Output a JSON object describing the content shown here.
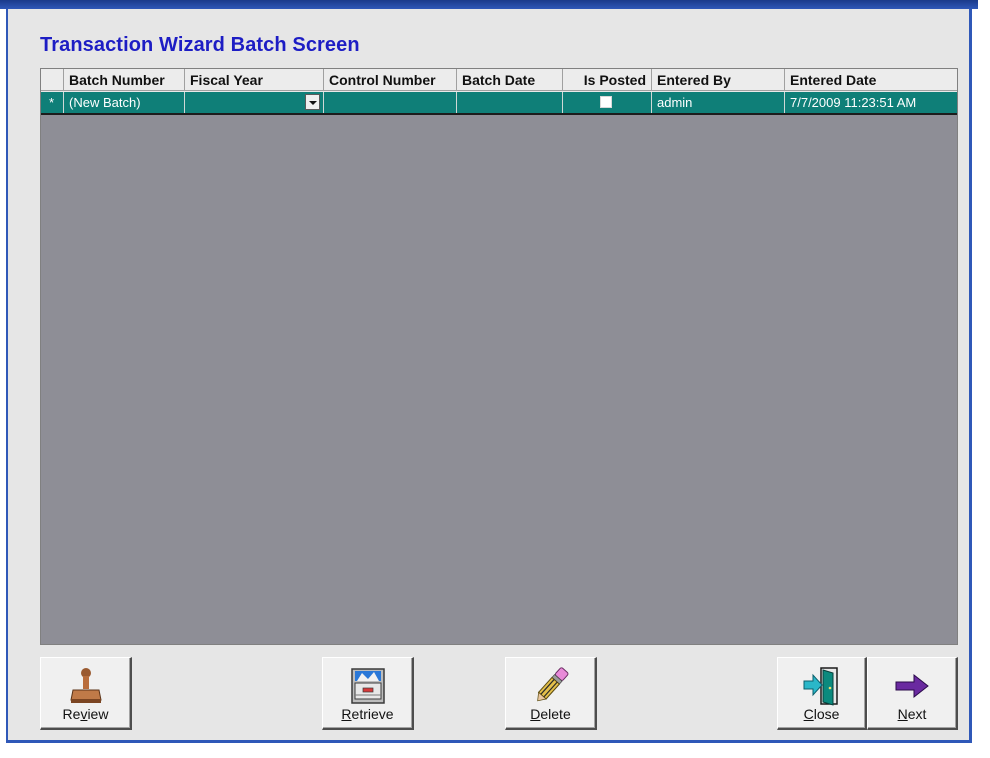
{
  "window": {
    "title": "Transaction Wizard Batch Screen"
  },
  "grid": {
    "columns": [
      "",
      "Batch Number",
      "Fiscal Year",
      "Control Number",
      "Batch Date",
      "Is Posted",
      "Entered By",
      "Entered Date"
    ],
    "row": {
      "indicator": "*",
      "batch_number": "(New Batch)",
      "fiscal_year": "",
      "control_number": "",
      "batch_date": "",
      "is_posted": false,
      "entered_by": "admin",
      "entered_date": "7/7/2009 11:23:51 AM"
    }
  },
  "buttons": {
    "review": {
      "pre": "Re",
      "mnemonic": "v",
      "post": "iew",
      "icon": "stamp-icon"
    },
    "retrieve": {
      "pre": "",
      "mnemonic": "R",
      "post": "etrieve",
      "icon": "file-drawer-icon"
    },
    "delete": {
      "pre": "",
      "mnemonic": "D",
      "post": "elete",
      "icon": "eraser-pencil-icon"
    },
    "close": {
      "pre": "",
      "mnemonic": "C",
      "post": "lose",
      "icon": "exit-door-icon"
    },
    "next": {
      "pre": "",
      "mnemonic": "N",
      "post": "ext",
      "icon": "right-arrow-icon"
    }
  },
  "colors": {
    "title": "#1d1dc4",
    "selected_row": "#0f7f78",
    "grid_background": "#8e8e96",
    "window_border": "#2f58b8"
  }
}
